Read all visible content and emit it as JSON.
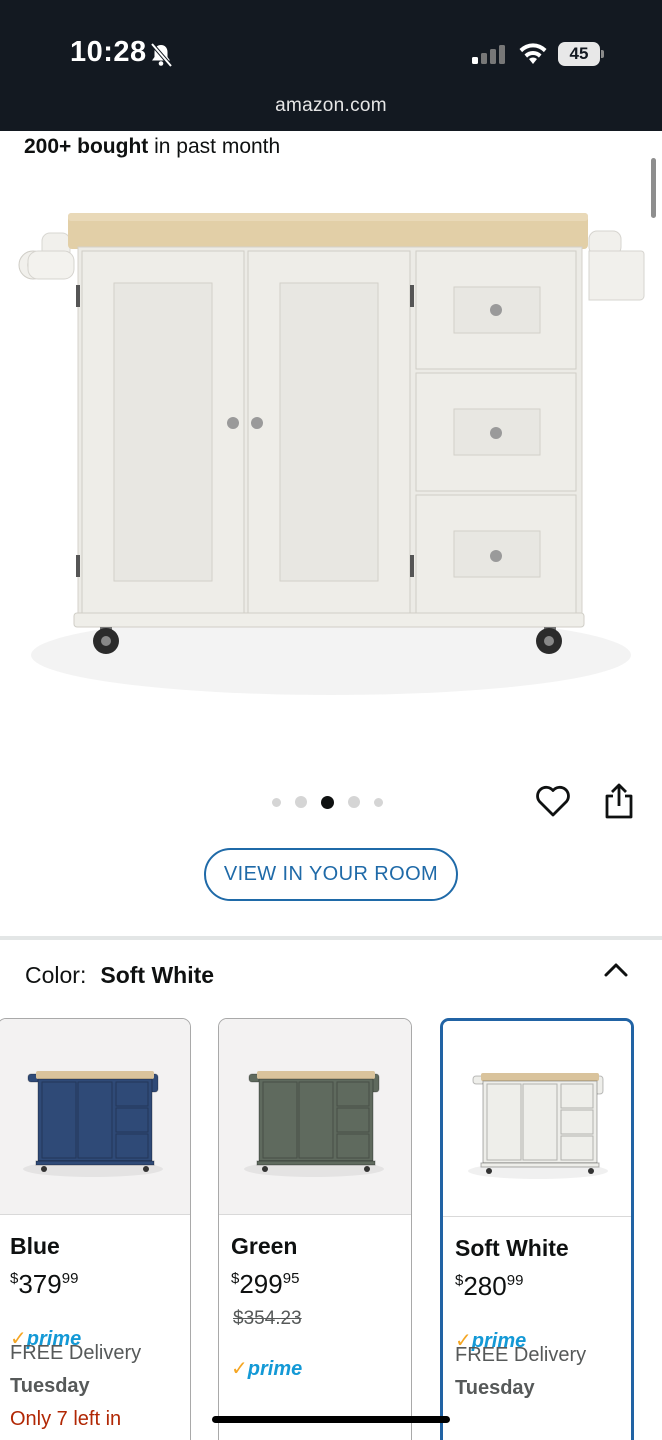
{
  "status_bar": {
    "time": "10:28",
    "battery": "45",
    "url": "amazon.com",
    "icons": [
      "bell-slash-icon",
      "signal-icon",
      "wifi-icon",
      "battery-icon"
    ]
  },
  "product": {
    "bought_bold": "200+ bought",
    "bought_rest": " in past month",
    "image_alt": "Kitchen cart with wood top, double doors and three drawers on casters",
    "carousel": {
      "count": 5,
      "active_index": 2
    },
    "view_in_room_label": "VIEW IN YOUR ROOM"
  },
  "color_section": {
    "label": "Color:",
    "selected": "Soft White"
  },
  "swatches": [
    {
      "name": "Blue",
      "price_symbol": "$",
      "price_whole": "379",
      "price_fraction": "99",
      "strike_price": "",
      "prime": "prime",
      "delivery": "FREE Delivery",
      "day": "Tuesday",
      "stock": "Only 7 left in",
      "cabinet_color": "#2f4a77"
    },
    {
      "name": "Green",
      "price_symbol": "$",
      "price_whole": "299",
      "price_fraction": "95",
      "strike_price": "$354.23",
      "prime": "prime",
      "delivery": "",
      "day": "",
      "stock": "",
      "cabinet_color": "#5f6a5e"
    },
    {
      "name": "Soft White",
      "price_symbol": "$",
      "price_whole": "280",
      "price_fraction": "99",
      "strike_price": "",
      "prime": "prime",
      "delivery": "FREE Delivery",
      "day": "Tuesday",
      "stock": "",
      "cabinet_color": "#eeeeea"
    }
  ],
  "colors": {
    "header_bg": "#131921",
    "link_blue": "#1f6aa8",
    "prime_blue": "#1399d6",
    "prime_check": "#f5a623",
    "stock_red": "#b12704",
    "selected_border": "#2163a4"
  }
}
